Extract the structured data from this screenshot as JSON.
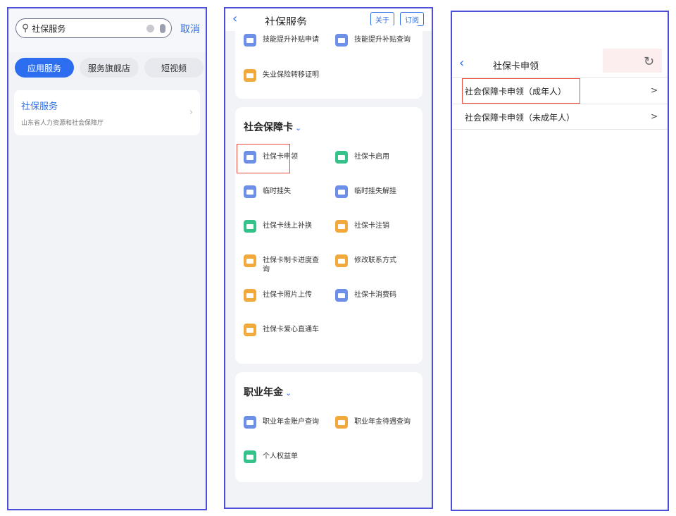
{
  "panel1": {
    "search_value": "社保服务",
    "cancel_label": "取消",
    "tabs": [
      "应用服务",
      "服务旗舰店",
      "短视频"
    ],
    "result": {
      "title": "社保服务",
      "subtitle": "山东省人力资源和社会保障厅"
    }
  },
  "panel2": {
    "title": "社保服务",
    "about_label": "关于",
    "subscribe_label": "订阅",
    "top_items": [
      "技能提升补贴申请",
      "技能提升补贴查询",
      "失业保险转移证明"
    ],
    "section1": {
      "title": "社会保障卡",
      "items": [
        {
          "label": "社保卡申领",
          "color": "#6e8fe8",
          "icon": "card-icon"
        },
        {
          "label": "社保卡启用",
          "color": "#35c28a",
          "icon": "card-icon"
        },
        {
          "label": "临时挂失",
          "color": "#6e8fe8",
          "icon": "card-icon"
        },
        {
          "label": "临时挂失解挂",
          "color": "#6e8fe8",
          "icon": "card-icon"
        },
        {
          "label": "社保卡线上补换",
          "color": "#35c28a",
          "icon": "card-icon"
        },
        {
          "label": "社保卡注销",
          "color": "#f2a93b",
          "icon": "card-icon"
        },
        {
          "label": "社保卡制卡进度查询",
          "color": "#f2a93b",
          "icon": "card-icon"
        },
        {
          "label": "修改联系方式",
          "color": "#f2a93b",
          "icon": "card-icon"
        },
        {
          "label": "社保卡照片上传",
          "color": "#f2a93b",
          "icon": "photo-icon"
        },
        {
          "label": "社保卡消费码",
          "color": "#6e8fe8",
          "icon": "qr-icon"
        },
        {
          "label": "社保卡爱心直通车",
          "color": "#f2a93b",
          "icon": "card-icon"
        }
      ]
    },
    "section2": {
      "title": "职业年金",
      "items": [
        {
          "label": "职业年金账户查询",
          "color": "#6e8fe8",
          "icon": "wallet-icon"
        },
        {
          "label": "职业年金待遇查询",
          "color": "#f2a93b",
          "icon": "document-icon"
        },
        {
          "label": "个人权益单",
          "color": "#35c28a",
          "icon": "printer-icon"
        }
      ]
    }
  },
  "panel3": {
    "title": "社保卡申领",
    "rows": [
      "社会保障卡申领（成年人）",
      "社会保障卡申领（未成年人）"
    ]
  },
  "colors": {
    "accent": "#2f6fe4",
    "frame": "#4d4fd8",
    "highlight": "#e74c3c"
  }
}
